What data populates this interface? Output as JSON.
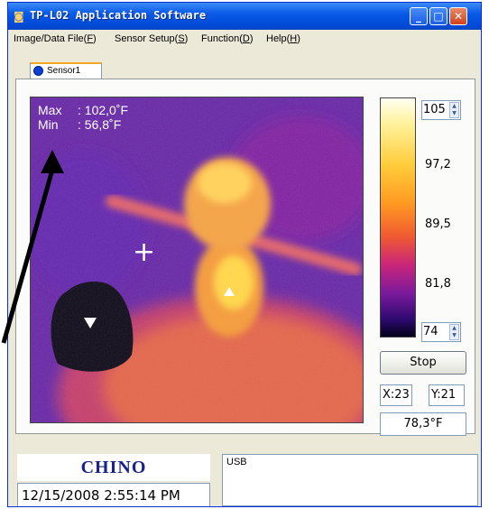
{
  "window": {
    "title": "TP-L02 Application Software",
    "app_icon": "camera-icon",
    "controls": [
      "_",
      "□",
      "✕"
    ]
  },
  "menu": [
    {
      "label_pre": "Image/Data File(",
      "key": "F",
      "label_post": ")"
    },
    {
      "label_pre": "Sensor Setup(",
      "key": "S",
      "label_post": ")"
    },
    {
      "label_pre": "Function(",
      "key": "D",
      "label_post": ")"
    },
    {
      "label_pre": "Help(",
      "key": "H",
      "label_post": ")"
    }
  ],
  "tab": {
    "label": "Sensor1",
    "icon": "sensor-dot-icon"
  },
  "thermal": {
    "max_label": "Max",
    "max_value": ": 102,0˚F",
    "min_label": "Min",
    "min_value": ": 56,8˚F",
    "crosshair": "+"
  },
  "scale": {
    "top_value": "105",
    "bottom_value": "74",
    "ticks": [
      "97,2",
      "89,5",
      "81,8"
    ],
    "spin_up": "▲",
    "spin_down": "▼"
  },
  "controls": {
    "stop_label": "Stop",
    "x_coord": "X:23",
    "y_coord": "Y:21",
    "temperature": "78,3°F"
  },
  "footer": {
    "logo": "CHINO",
    "datetime": "12/15/2008 2:55:14 PM",
    "status": "USB"
  },
  "colors": {
    "title_bar": "#0a5ae8",
    "logo": "#17228a",
    "window_bg": "#ece9d8"
  }
}
